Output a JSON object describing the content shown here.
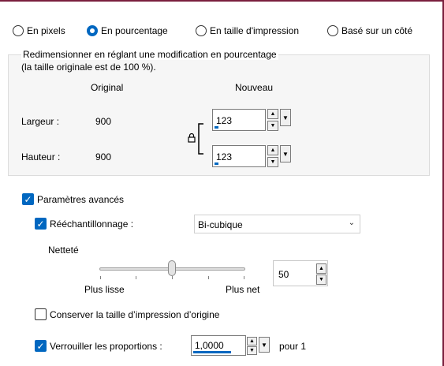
{
  "mode_radios": [
    {
      "label": "En pixels",
      "selected": false
    },
    {
      "label": "En pourcentage",
      "selected": true
    },
    {
      "label": "En taille d'impression",
      "selected": false
    },
    {
      "label": "Basé sur un côté",
      "selected": false
    }
  ],
  "group": {
    "line1": "Redimensionner en réglant une modification en pourcentage",
    "line2": "(la taille originale est de 100 %).",
    "col_original": "Original",
    "col_new": "Nouveau",
    "width_label": "Largeur :",
    "width_original": "900",
    "width_new": "123",
    "height_label": "Hauteur :",
    "height_original": "900",
    "height_new": "123"
  },
  "advanced": {
    "label": "Paramètres avancés",
    "checked": true,
    "resample_label": "Rééchantillonnage :",
    "resample_checked": true,
    "resample_method": "Bi-cubique",
    "sharpness_label": "Netteté",
    "slider_min_label": "Plus lisse",
    "slider_max_label": "Plus net",
    "sharpness_value": "50",
    "keep_print_size_label": "Conserver la taille d’impression d’origine",
    "keep_print_size_checked": false,
    "lock_ratio_label": "Verrouiller les proportions :",
    "lock_ratio_checked": true,
    "ratio_value": "1,0000",
    "ratio_suffix": "pour 1"
  },
  "colors": {
    "accent": "#0067c0",
    "border_top": "#7a1f3d"
  }
}
